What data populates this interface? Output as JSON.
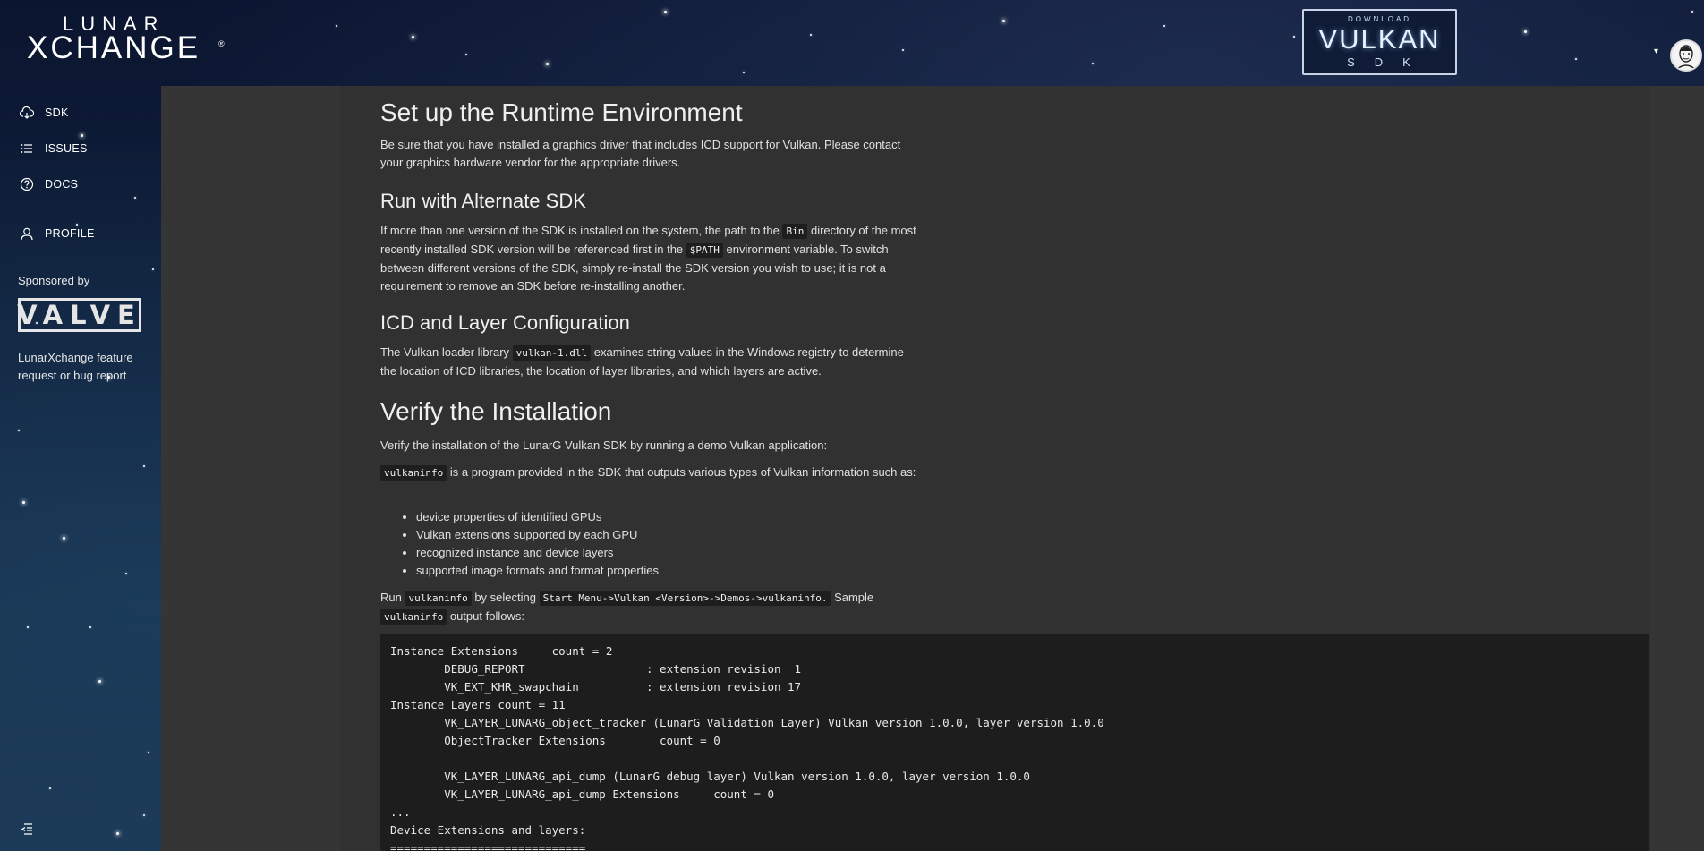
{
  "header": {
    "logo_top": "LUNAR",
    "logo_main": "XCHANGE",
    "logo_reg": "®",
    "badge_download": "DOWNLOAD",
    "badge_vulkan": "VULKAN",
    "badge_sdk": "SDK",
    "caret": "▾"
  },
  "sidebar": {
    "items": [
      {
        "label": "SDK",
        "icon": "cloud-download-icon"
      },
      {
        "label": "ISSUES",
        "icon": "list-icon"
      },
      {
        "label": "DOCS",
        "icon": "question-circle-icon"
      },
      {
        "label": "PROFILE",
        "icon": "user-icon"
      }
    ],
    "sponsored_by": "Sponsored by",
    "sponsor_logo": "VALVE",
    "report_link": "LunarXchange feature request or bug report"
  },
  "content": {
    "h_runtime": "Set up the Runtime Environment",
    "p_runtime": "Be sure that you have installed a graphics driver that includes ICD support for Vulkan. Please contact your graphics hardware vendor for the appropriate drivers.",
    "h_alt": "Run with Alternate SDK",
    "p_alt_1": "If more than one version of the SDK is installed on the system, the path to the ",
    "p_alt_code1": "Bin",
    "p_alt_2": " directory of the most recently installed SDK version will be referenced first in the ",
    "p_alt_code2": "$PATH",
    "p_alt_3": " environment variable. To switch between different versions of the SDK, simply re-install the SDK version you wish to use; it is not a requirement to remove an SDK before re-installing another.",
    "h_icd": "ICD and Layer Configuration",
    "p_icd_1": "The Vulkan loader library ",
    "p_icd_code": "vulkan-1.dll",
    "p_icd_2": " examines string values in the Windows registry to determine the location of ICD libraries, the location of layer libraries, and which layers are active.",
    "h_verify": "Verify the Installation",
    "p_verify": "Verify the installation of the LunarG Vulkan SDK by running a demo Vulkan application:",
    "p_vi_code": "vulkaninfo",
    "p_vi_text": " is a program provided in the SDK that outputs various types of Vulkan information such as:",
    "list": [
      "device properties of identified GPUs",
      "Vulkan extensions supported by each GPU",
      "recognized instance and device layers",
      "supported image formats and format properties"
    ],
    "p_run_1": "Run ",
    "p_run_code1": "vulkaninfo",
    "p_run_2": " by selecting ",
    "p_run_code2": "Start Menu->Vulkan <Version>->Demos->vulkaninfo.",
    "p_run_3": " Sample ",
    "p_run_code3": "vulkaninfo",
    "p_run_4": " output follows:",
    "pre": "Instance Extensions\tcount = 2\n\tDEBUG_REPORT                  : extension revision  1\n\tVK_EXT_KHR_swapchain          : extension revision 17\nInstance Layers count = 11\n\tVK_LAYER_LUNARG_object_tracker (LunarG Validation Layer) Vulkan version 1.0.0, layer version 1.0.0\n\tObjectTracker Extensions\tcount = 0\n\n\tVK_LAYER_LUNARG_api_dump (LunarG debug layer) Vulkan version 1.0.0, layer version 1.0.0\n\tVK_LAYER_LUNARG_api_dump Extensions\tcount = 0\n...\nDevice Extensions and layers:\n============================="
  }
}
